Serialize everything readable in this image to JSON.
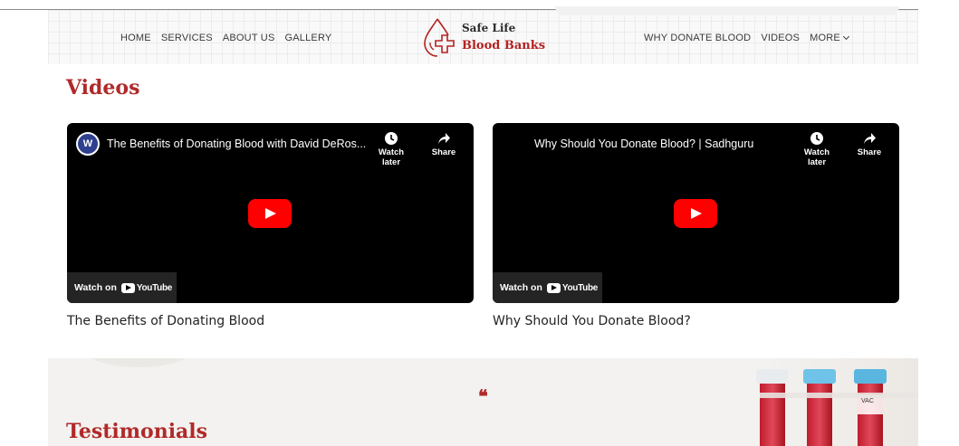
{
  "header": {
    "nav_left": [
      "HOME",
      "SERVICES",
      "ABOUT US",
      "GALLERY"
    ],
    "nav_right": [
      "WHY DONATE BLOOD",
      "VIDEOS"
    ],
    "more_label": "MORE",
    "logo": {
      "line1": "Safe Life",
      "line2": "Blood Banks"
    }
  },
  "videos_section": {
    "title": "Videos",
    "items": [
      {
        "embed_title": "The Benefits of Donating Blood with David DeRos...",
        "channel_initials": "W",
        "watch_later": "Watch later",
        "share": "Share",
        "watch_on": "Watch on",
        "youtube": "YouTube",
        "caption": "The Benefits of Donating Blood"
      },
      {
        "embed_title": "Why Should You Donate Blood? | Sadhguru",
        "watch_later": "Watch later",
        "share": "Share",
        "watch_on": "Watch on",
        "youtube": "YouTube",
        "caption": "Why Should You Donate Blood?"
      }
    ]
  },
  "testimonials": {
    "quote_mark": "❝",
    "title": "Testimonials",
    "tube_label": "VAC"
  },
  "colors": {
    "brand_red": "#b02a2a",
    "youtube_red": "#ff0000",
    "player_bg": "#000000"
  },
  "icons": [
    "logo-blood-drop-cross-icon",
    "clock-icon",
    "share-arrow-icon",
    "play-icon",
    "youtube-logo-icon",
    "chevron-down-icon",
    "quote-icon"
  ]
}
